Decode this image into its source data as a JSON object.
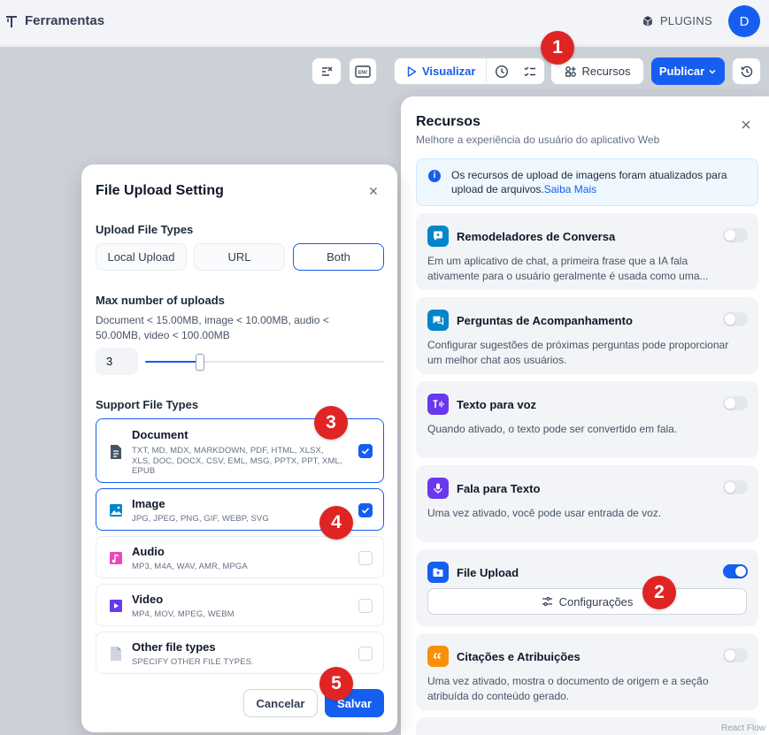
{
  "header": {
    "title": "Ferramentas",
    "plugins_label": "PLUGINS",
    "avatar_initial": "D"
  },
  "toolbar": {
    "visualize_label": "Visualizar",
    "resources_label": "Recursos",
    "publish_label": "Publicar"
  },
  "badges": [
    "1",
    "2",
    "3",
    "4",
    "5"
  ],
  "resources_panel": {
    "title": "Recursos",
    "subtitle": "Melhore a experiência do usuário do aplicativo Web",
    "info_text": "Os recursos de upload de imagens foram atualizados para upload de arquivos.",
    "info_link": "Saiba Mais",
    "features": [
      {
        "name": "Remodeladores de Conversa",
        "desc": "Em um aplicativo de chat, a primeira frase que a IA fala ativamente para o usuário geralmente é usada como uma...",
        "enabled": false,
        "color": "#0086c9"
      },
      {
        "name": "Perguntas de Acompanhamento",
        "desc": "Configurar sugestões de próximas perguntas pode proporcionar um melhor chat aos usuários.",
        "enabled": false,
        "color": "#0086c9"
      },
      {
        "name": "Texto para voz",
        "desc": "Quando ativado, o texto pode ser convertido em fala.",
        "enabled": false,
        "color": "#6938ef"
      },
      {
        "name": "Fala para Texto",
        "desc": "Uma vez ativado, você pode usar entrada de voz.",
        "enabled": false,
        "color": "#6938ef"
      },
      {
        "name": "File Upload",
        "desc": "",
        "enabled": true,
        "color": "#155eef"
      },
      {
        "name": "Citações e Atribuições",
        "desc": "Uma vez ativado, mostra o documento de origem e a seção atribuída do conteúdo gerado.",
        "enabled": false,
        "color": "#f79009"
      }
    ],
    "config_button": "Configurações"
  },
  "file_upload_modal": {
    "title": "File Upload Setting",
    "upload_types_label": "Upload File Types",
    "upload_type_options": [
      "Local Upload",
      "URL",
      "Both"
    ],
    "selected_upload_type": "Both",
    "max_uploads_label": "Max number of uploads",
    "limits_text": "Document < 15.00MB, image < 10.00MB, audio < 50.00MB, video < 100.00MB",
    "max_uploads_value": "3",
    "max_uploads_fraction": 0.23,
    "support_label": "Support File Types",
    "file_types": [
      {
        "name": "Document",
        "desc": "TXT, MD, MDX, MARKDOWN, PDF, HTML, XLSX, XLS, DOC, DOCX, CSV, EML, MSG, PPTX, PPT, XML, EPUB",
        "checked": true,
        "color": "#475467"
      },
      {
        "name": "Image",
        "desc": "JPG, JPEG, PNG, GIF, WEBP, SVG",
        "checked": true,
        "color": "#0086c9"
      },
      {
        "name": "Audio",
        "desc": "MP3, M4A, WAV, AMR, MPGA",
        "checked": false,
        "color": "#ee46bc"
      },
      {
        "name": "Video",
        "desc": "MP4, MOV, MPEG, WEBM",
        "checked": false,
        "color": "#6938ef"
      },
      {
        "name": "Other file types",
        "desc": "SPECIFY OTHER FILE TYPES.",
        "checked": false,
        "color": "#d0d5dd"
      }
    ],
    "cancel_label": "Cancelar",
    "save_label": "Salvar"
  },
  "corner_text": "React Flow"
}
